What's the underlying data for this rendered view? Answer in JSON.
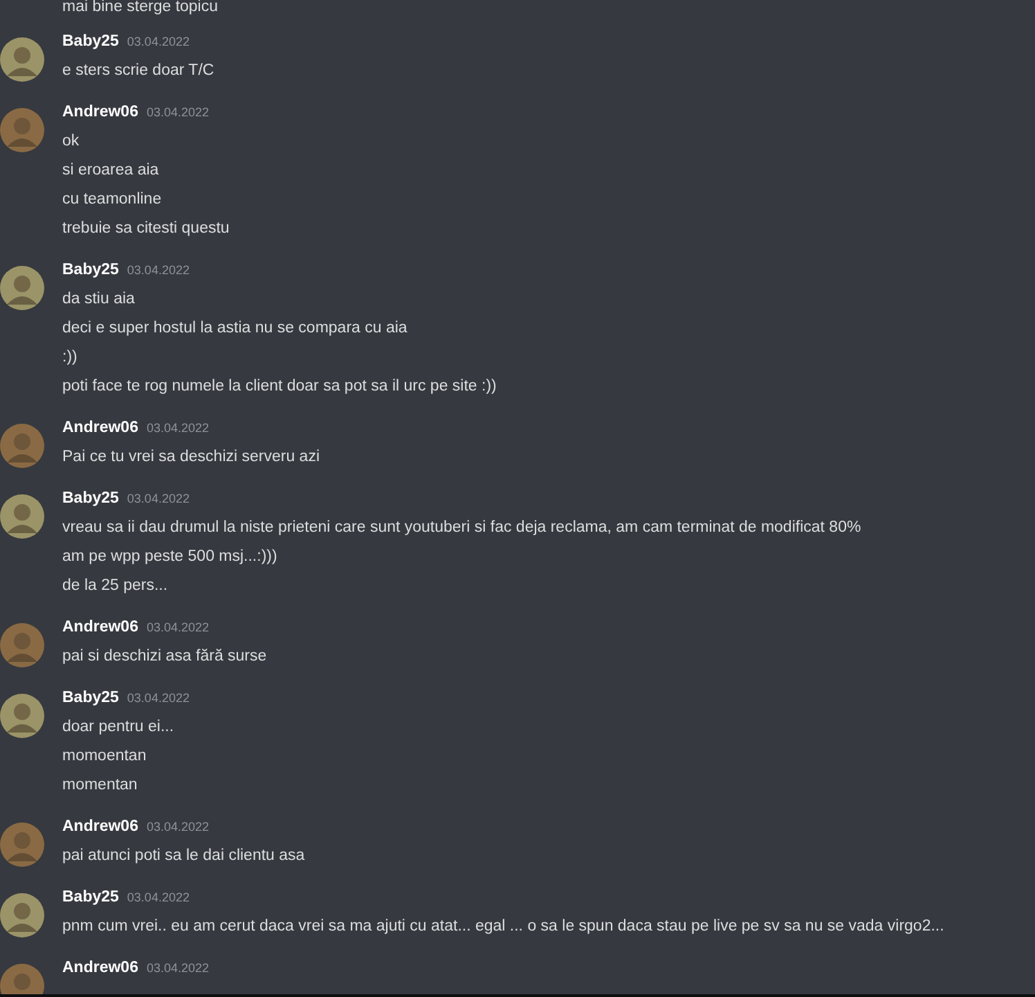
{
  "continued_line": "mai bine sterge topicu",
  "messages": [
    {
      "author": "Baby25",
      "date": "03.04.2022",
      "color": "#9a9468",
      "lines": [
        "e sters scrie doar T/C"
      ]
    },
    {
      "author": "Andrew06",
      "date": "03.04.2022",
      "color": "#8a6a44",
      "lines": [
        "ok",
        "si eroarea aia",
        "cu teamonline",
        "trebuie sa citesti questu"
      ]
    },
    {
      "author": "Baby25",
      "date": "03.04.2022",
      "color": "#9a9468",
      "lines": [
        "da stiu aia",
        "deci e super hostul la astia nu se compara cu aia",
        ":))",
        "poti face te rog numele la client doar sa pot sa il urc pe site :))"
      ]
    },
    {
      "author": "Andrew06",
      "date": "03.04.2022",
      "color": "#8a6a44",
      "lines": [
        "Pai ce tu vrei sa deschizi serveru azi"
      ]
    },
    {
      "author": "Baby25",
      "date": "03.04.2022",
      "color": "#9a9468",
      "lines": [
        "vreau sa ii dau drumul la niste prieteni care sunt youtuberi si fac deja reclama, am cam terminat de modificat 80%",
        "am pe wpp peste 500 msj...:)))",
        "de la 25 pers..."
      ]
    },
    {
      "author": "Andrew06",
      "date": "03.04.2022",
      "color": "#8a6a44",
      "lines": [
        "pai si deschizi asa fără surse"
      ]
    },
    {
      "author": "Baby25",
      "date": "03.04.2022",
      "color": "#9a9468",
      "lines": [
        "doar pentru ei...",
        "momoentan",
        "momentan"
      ]
    },
    {
      "author": "Andrew06",
      "date": "03.04.2022",
      "color": "#8a6a44",
      "lines": [
        "pai atunci poti sa le dai clientu asa"
      ]
    },
    {
      "author": "Baby25",
      "date": "03.04.2022",
      "color": "#9a9468",
      "lines": [
        "pnm cum vrei.. eu am cerut daca vrei sa ma ajuti cu atat... egal ... o sa le spun daca stau pe live pe sv sa nu se vada virgo2..."
      ]
    },
    {
      "author": "Andrew06",
      "date": "03.04.2022",
      "color": "#8a6a44"
    }
  ]
}
